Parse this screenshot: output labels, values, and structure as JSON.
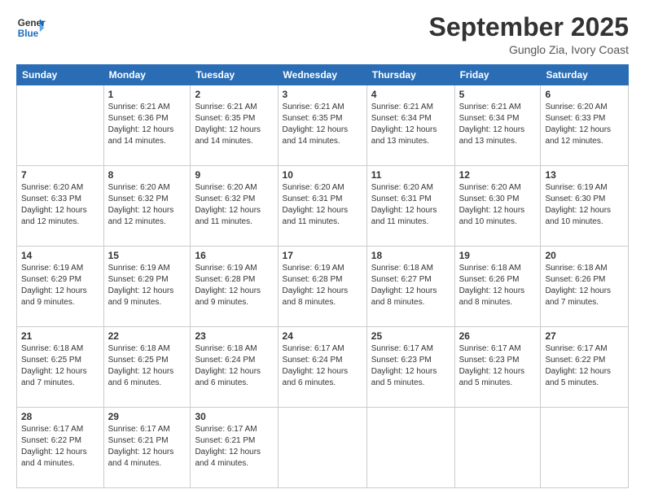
{
  "logo": {
    "line1": "General",
    "line2": "Blue"
  },
  "title": "September 2025",
  "subtitle": "Gunglo Zia, Ivory Coast",
  "days": [
    "Sunday",
    "Monday",
    "Tuesday",
    "Wednesday",
    "Thursday",
    "Friday",
    "Saturday"
  ],
  "weeks": [
    [
      {
        "day": "",
        "text": ""
      },
      {
        "day": "1",
        "text": "Sunrise: 6:21 AM\nSunset: 6:36 PM\nDaylight: 12 hours\nand 14 minutes."
      },
      {
        "day": "2",
        "text": "Sunrise: 6:21 AM\nSunset: 6:35 PM\nDaylight: 12 hours\nand 14 minutes."
      },
      {
        "day": "3",
        "text": "Sunrise: 6:21 AM\nSunset: 6:35 PM\nDaylight: 12 hours\nand 14 minutes."
      },
      {
        "day": "4",
        "text": "Sunrise: 6:21 AM\nSunset: 6:34 PM\nDaylight: 12 hours\nand 13 minutes."
      },
      {
        "day": "5",
        "text": "Sunrise: 6:21 AM\nSunset: 6:34 PM\nDaylight: 12 hours\nand 13 minutes."
      },
      {
        "day": "6",
        "text": "Sunrise: 6:20 AM\nSunset: 6:33 PM\nDaylight: 12 hours\nand 12 minutes."
      }
    ],
    [
      {
        "day": "7",
        "text": "Sunrise: 6:20 AM\nSunset: 6:33 PM\nDaylight: 12 hours\nand 12 minutes."
      },
      {
        "day": "8",
        "text": "Sunrise: 6:20 AM\nSunset: 6:32 PM\nDaylight: 12 hours\nand 12 minutes."
      },
      {
        "day": "9",
        "text": "Sunrise: 6:20 AM\nSunset: 6:32 PM\nDaylight: 12 hours\nand 11 minutes."
      },
      {
        "day": "10",
        "text": "Sunrise: 6:20 AM\nSunset: 6:31 PM\nDaylight: 12 hours\nand 11 minutes."
      },
      {
        "day": "11",
        "text": "Sunrise: 6:20 AM\nSunset: 6:31 PM\nDaylight: 12 hours\nand 11 minutes."
      },
      {
        "day": "12",
        "text": "Sunrise: 6:20 AM\nSunset: 6:30 PM\nDaylight: 12 hours\nand 10 minutes."
      },
      {
        "day": "13",
        "text": "Sunrise: 6:19 AM\nSunset: 6:30 PM\nDaylight: 12 hours\nand 10 minutes."
      }
    ],
    [
      {
        "day": "14",
        "text": "Sunrise: 6:19 AM\nSunset: 6:29 PM\nDaylight: 12 hours\nand 9 minutes."
      },
      {
        "day": "15",
        "text": "Sunrise: 6:19 AM\nSunset: 6:29 PM\nDaylight: 12 hours\nand 9 minutes."
      },
      {
        "day": "16",
        "text": "Sunrise: 6:19 AM\nSunset: 6:28 PM\nDaylight: 12 hours\nand 9 minutes."
      },
      {
        "day": "17",
        "text": "Sunrise: 6:19 AM\nSunset: 6:28 PM\nDaylight: 12 hours\nand 8 minutes."
      },
      {
        "day": "18",
        "text": "Sunrise: 6:18 AM\nSunset: 6:27 PM\nDaylight: 12 hours\nand 8 minutes."
      },
      {
        "day": "19",
        "text": "Sunrise: 6:18 AM\nSunset: 6:26 PM\nDaylight: 12 hours\nand 8 minutes."
      },
      {
        "day": "20",
        "text": "Sunrise: 6:18 AM\nSunset: 6:26 PM\nDaylight: 12 hours\nand 7 minutes."
      }
    ],
    [
      {
        "day": "21",
        "text": "Sunrise: 6:18 AM\nSunset: 6:25 PM\nDaylight: 12 hours\nand 7 minutes."
      },
      {
        "day": "22",
        "text": "Sunrise: 6:18 AM\nSunset: 6:25 PM\nDaylight: 12 hours\nand 6 minutes."
      },
      {
        "day": "23",
        "text": "Sunrise: 6:18 AM\nSunset: 6:24 PM\nDaylight: 12 hours\nand 6 minutes."
      },
      {
        "day": "24",
        "text": "Sunrise: 6:17 AM\nSunset: 6:24 PM\nDaylight: 12 hours\nand 6 minutes."
      },
      {
        "day": "25",
        "text": "Sunrise: 6:17 AM\nSunset: 6:23 PM\nDaylight: 12 hours\nand 5 minutes."
      },
      {
        "day": "26",
        "text": "Sunrise: 6:17 AM\nSunset: 6:23 PM\nDaylight: 12 hours\nand 5 minutes."
      },
      {
        "day": "27",
        "text": "Sunrise: 6:17 AM\nSunset: 6:22 PM\nDaylight: 12 hours\nand 5 minutes."
      }
    ],
    [
      {
        "day": "28",
        "text": "Sunrise: 6:17 AM\nSunset: 6:22 PM\nDaylight: 12 hours\nand 4 minutes."
      },
      {
        "day": "29",
        "text": "Sunrise: 6:17 AM\nSunset: 6:21 PM\nDaylight: 12 hours\nand 4 minutes."
      },
      {
        "day": "30",
        "text": "Sunrise: 6:17 AM\nSunset: 6:21 PM\nDaylight: 12 hours\nand 4 minutes."
      },
      {
        "day": "",
        "text": ""
      },
      {
        "day": "",
        "text": ""
      },
      {
        "day": "",
        "text": ""
      },
      {
        "day": "",
        "text": ""
      }
    ]
  ]
}
